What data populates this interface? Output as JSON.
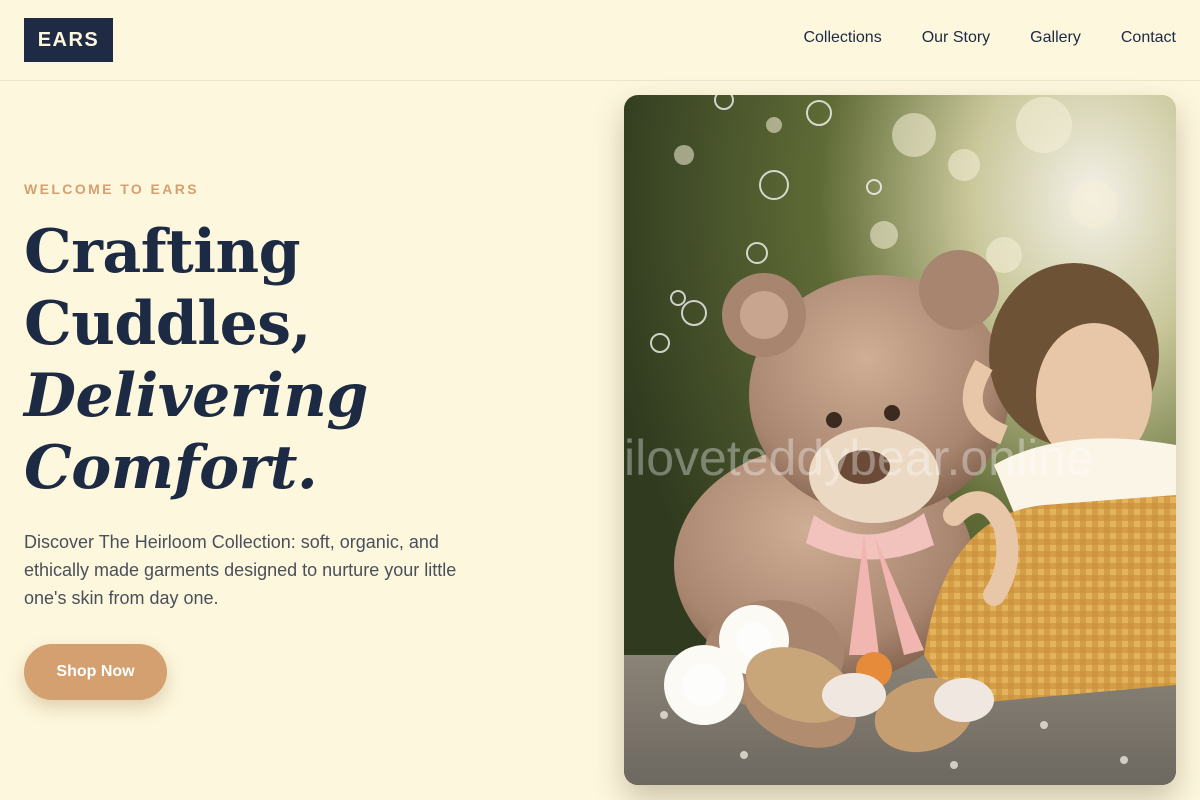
{
  "brand": {
    "logo_text": "EARS"
  },
  "nav": {
    "items": [
      "Collections",
      "Our Story",
      "Gallery",
      "Contact"
    ]
  },
  "hero": {
    "eyebrow": "WELCOME TO EARS",
    "headline": {
      "line1": "Crafting",
      "line2": "Cuddles,",
      "line3": "Delivering",
      "line4": "Comfort."
    },
    "description": "Discover The Heirloom Collection: soft, organic, and ethically made garments designed to nurture your little one's skin from day one.",
    "cta_label": "Shop Now",
    "image": {
      "subject": "teddy bear and baby girl on a blanket with soap bubbles",
      "watermark": "iloveteddybear.online"
    }
  },
  "colors": {
    "background": "#fdf7dd",
    "navy": "#1d2a44",
    "accent": "#d4a06f"
  }
}
